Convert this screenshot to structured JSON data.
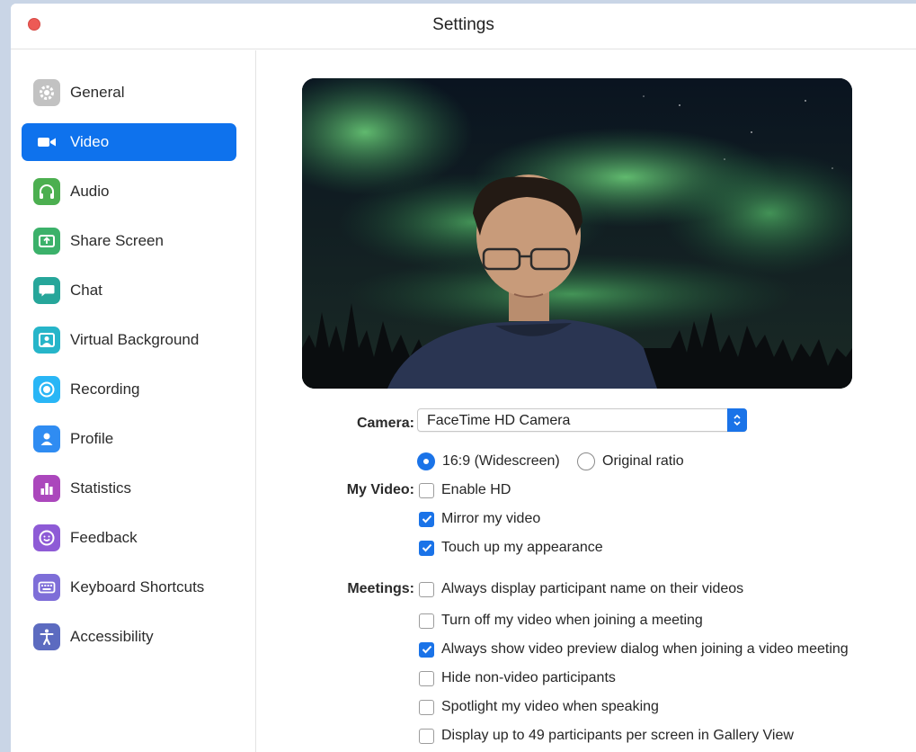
{
  "window": {
    "title": "Settings"
  },
  "sidebar": {
    "items": [
      {
        "label": "General",
        "icon": "gear-icon",
        "color": "#c2c2c2",
        "active": false
      },
      {
        "label": "Video",
        "icon": "video-camera-icon",
        "color": "#0e72ed",
        "active": true
      },
      {
        "label": "Audio",
        "icon": "headphones-icon",
        "color": "#4caf50",
        "active": false
      },
      {
        "label": "Share Screen",
        "icon": "share-screen-icon",
        "color": "#3bb16a",
        "active": false
      },
      {
        "label": "Chat",
        "icon": "chat-bubble-icon",
        "color": "#26a69a",
        "active": false
      },
      {
        "label": "Virtual Background",
        "icon": "person-portrait-icon",
        "color": "#26b5c9",
        "active": false
      },
      {
        "label": "Recording",
        "icon": "record-icon",
        "color": "#29b6f6",
        "active": false
      },
      {
        "label": "Profile",
        "icon": "person-icon",
        "color": "#2f8cf2",
        "active": false
      },
      {
        "label": "Statistics",
        "icon": "bar-chart-icon",
        "color": "#ab47bc",
        "active": false
      },
      {
        "label": "Feedback",
        "icon": "smiley-icon",
        "color": "#8e5bd6",
        "active": false
      },
      {
        "label": "Keyboard Shortcuts",
        "icon": "keyboard-icon",
        "color": "#7e6ed8",
        "active": false
      },
      {
        "label": "Accessibility",
        "icon": "accessibility-icon",
        "color": "#5c6bc0",
        "active": false
      }
    ]
  },
  "video": {
    "camera": {
      "label": "Camera:",
      "value": "FaceTime HD Camera"
    },
    "ratio": {
      "widescreen": {
        "label": "16:9 (Widescreen)",
        "selected": true
      },
      "original": {
        "label": "Original ratio",
        "selected": false
      }
    },
    "my_video": {
      "label": "My Video:",
      "options": [
        {
          "label": "Enable HD",
          "checked": false
        },
        {
          "label": "Mirror my video",
          "checked": true
        },
        {
          "label": "Touch up my appearance",
          "checked": true
        }
      ]
    },
    "meetings": {
      "label": "Meetings:",
      "options": [
        {
          "label": "Always display participant name on their videos",
          "checked": false
        },
        {
          "label": "Turn off my video when joining a meeting",
          "checked": false
        },
        {
          "label": "Always show video preview dialog when joining a video meeting",
          "checked": true
        },
        {
          "label": "Hide non-video participants",
          "checked": false
        },
        {
          "label": "Spotlight my video when speaking",
          "checked": false
        },
        {
          "label": "Display up to 49 participants per screen in Gallery View",
          "checked": false
        }
      ]
    }
  }
}
